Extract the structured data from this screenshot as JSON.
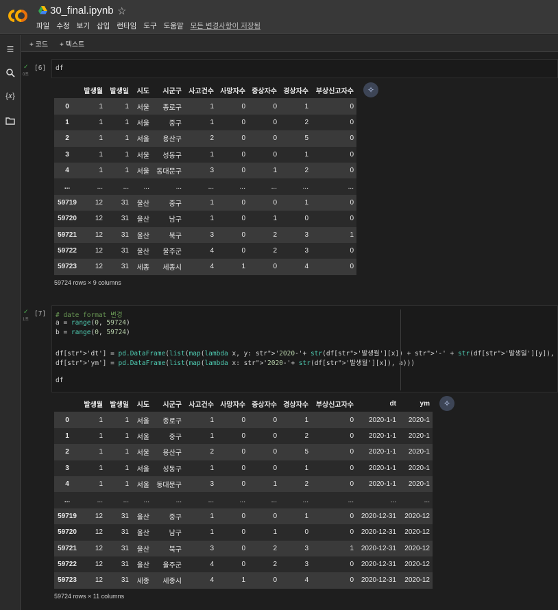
{
  "header": {
    "title": "30_final.ipynb",
    "menu": [
      "파일",
      "수정",
      "보기",
      "삽입",
      "런타임",
      "도구",
      "도움말"
    ],
    "saved_status": "모든 변경사항이 저장됨"
  },
  "toolbar": {
    "add_code": "+ 코드",
    "add_text": "+ 텍스트"
  },
  "sidebar": {
    "icons": [
      "menu-icon",
      "search-icon",
      "variables-icon",
      "folder-icon"
    ]
  },
  "cells": [
    {
      "exec": "[6]",
      "time": "0초",
      "code": [
        "df"
      ],
      "table": {
        "columns": [
          "",
          "발생월",
          "발생일",
          "시도",
          "시군구",
          "사고건수",
          "사망자수",
          "중상자수",
          "경상자수",
          "부상신고자수"
        ],
        "rows": [
          [
            "0",
            "1",
            "1",
            "서울",
            "종로구",
            "1",
            "0",
            "0",
            "1",
            "0"
          ],
          [
            "1",
            "1",
            "1",
            "서울",
            "중구",
            "1",
            "0",
            "0",
            "2",
            "0"
          ],
          [
            "2",
            "1",
            "1",
            "서울",
            "용산구",
            "2",
            "0",
            "0",
            "5",
            "0"
          ],
          [
            "3",
            "1",
            "1",
            "서울",
            "성동구",
            "1",
            "0",
            "0",
            "1",
            "0"
          ],
          [
            "4",
            "1",
            "1",
            "서울",
            "동대문구",
            "3",
            "0",
            "1",
            "2",
            "0"
          ],
          [
            "...",
            "...",
            "...",
            "...",
            "...",
            "...",
            "...",
            "...",
            "...",
            "..."
          ],
          [
            "59719",
            "12",
            "31",
            "울산",
            "중구",
            "1",
            "0",
            "0",
            "1",
            "0"
          ],
          [
            "59720",
            "12",
            "31",
            "울산",
            "남구",
            "1",
            "0",
            "1",
            "0",
            "0"
          ],
          [
            "59721",
            "12",
            "31",
            "울산",
            "북구",
            "3",
            "0",
            "2",
            "3",
            "1"
          ],
          [
            "59722",
            "12",
            "31",
            "울산",
            "울주군",
            "4",
            "0",
            "2",
            "3",
            "0"
          ],
          [
            "59723",
            "12",
            "31",
            "세종",
            "세종시",
            "4",
            "1",
            "0",
            "4",
            "0"
          ]
        ],
        "shape": "59724 rows × 9 columns"
      }
    },
    {
      "exec": "[7]",
      "time": "1초",
      "code": [
        "# date format 변경",
        "a = range(0, 59724)",
        "b = range(0, 59724)",
        "",
        "df['dt'] = pd.DataFrame(list(map(lambda x, y: '2020-'+ str(df['발생월'][x]) + '-' + str(df['발생일'][y]), a, b)))",
        "df['ym'] = pd.DataFrame(list(map(lambda x: '2020-'+ str(df['발생월'][x]), a)))",
        "",
        "df"
      ],
      "table": {
        "columns": [
          "",
          "발생월",
          "발생일",
          "시도",
          "시군구",
          "사고건수",
          "사망자수",
          "중상자수",
          "경상자수",
          "부상신고자수",
          "dt",
          "ym"
        ],
        "rows": [
          [
            "0",
            "1",
            "1",
            "서울",
            "종로구",
            "1",
            "0",
            "0",
            "1",
            "0",
            "2020-1-1",
            "2020-1"
          ],
          [
            "1",
            "1",
            "1",
            "서울",
            "중구",
            "1",
            "0",
            "0",
            "2",
            "0",
            "2020-1-1",
            "2020-1"
          ],
          [
            "2",
            "1",
            "1",
            "서울",
            "용산구",
            "2",
            "0",
            "0",
            "5",
            "0",
            "2020-1-1",
            "2020-1"
          ],
          [
            "3",
            "1",
            "1",
            "서울",
            "성동구",
            "1",
            "0",
            "0",
            "1",
            "0",
            "2020-1-1",
            "2020-1"
          ],
          [
            "4",
            "1",
            "1",
            "서울",
            "동대문구",
            "3",
            "0",
            "1",
            "2",
            "0",
            "2020-1-1",
            "2020-1"
          ],
          [
            "...",
            "...",
            "...",
            "...",
            "...",
            "...",
            "...",
            "...",
            "...",
            "...",
            "...",
            "..."
          ],
          [
            "59719",
            "12",
            "31",
            "울산",
            "중구",
            "1",
            "0",
            "0",
            "1",
            "0",
            "2020-12-31",
            "2020-12"
          ],
          [
            "59720",
            "12",
            "31",
            "울산",
            "남구",
            "1",
            "0",
            "1",
            "0",
            "0",
            "2020-12-31",
            "2020-12"
          ],
          [
            "59721",
            "12",
            "31",
            "울산",
            "북구",
            "3",
            "0",
            "2",
            "3",
            "1",
            "2020-12-31",
            "2020-12"
          ],
          [
            "59722",
            "12",
            "31",
            "울산",
            "울주군",
            "4",
            "0",
            "2",
            "3",
            "0",
            "2020-12-31",
            "2020-12"
          ],
          [
            "59723",
            "12",
            "31",
            "세종",
            "세종시",
            "4",
            "1",
            "0",
            "4",
            "0",
            "2020-12-31",
            "2020-12"
          ]
        ],
        "shape": "59724 rows × 11 columns"
      }
    }
  ]
}
